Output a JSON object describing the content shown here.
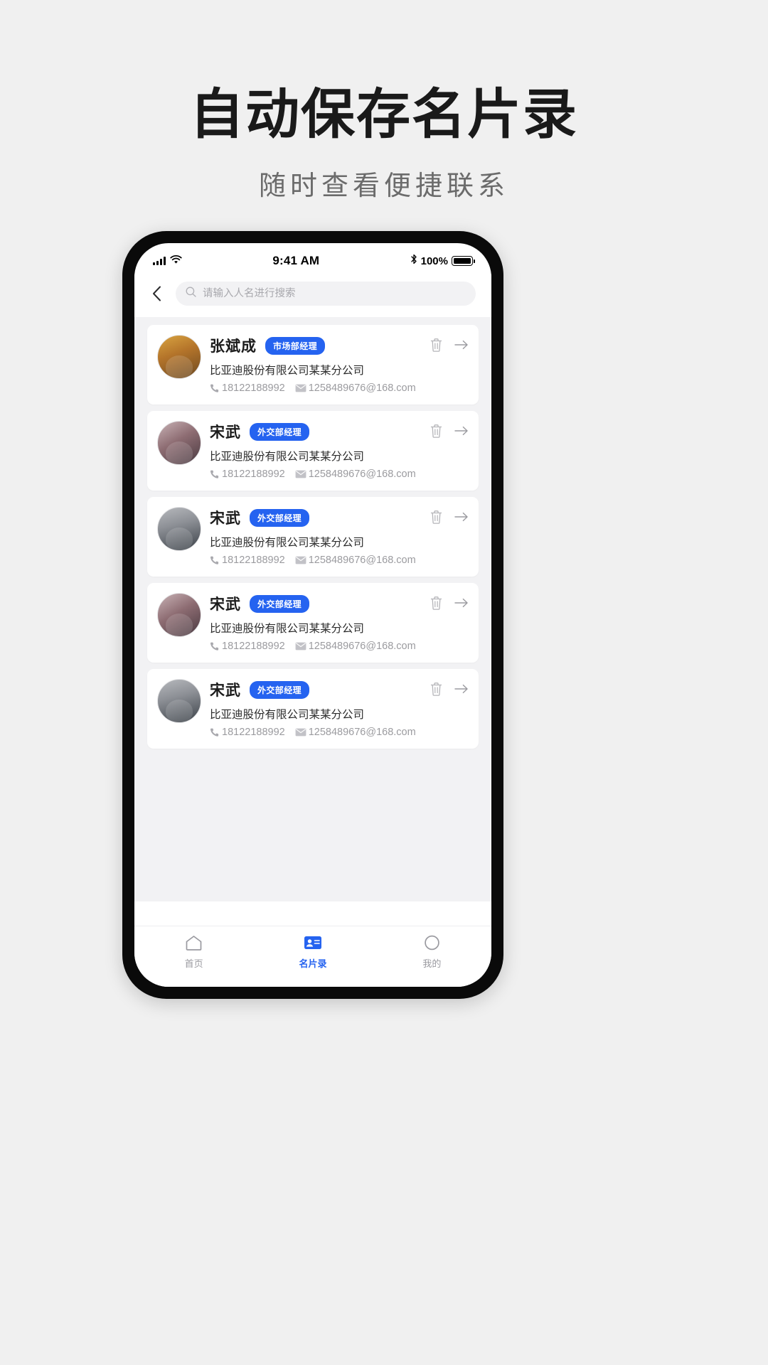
{
  "promo": {
    "title": "自动保存名片录",
    "subtitle": "随时查看便捷联系"
  },
  "statusbar": {
    "time": "9:41 AM",
    "battery_percent": "100%",
    "signal_icon": "cellular-signal-icon",
    "wifi_icon": "wifi-icon",
    "bluetooth_icon": "bluetooth-icon",
    "battery_icon": "battery-full-icon"
  },
  "header": {
    "back_icon": "chevron-left-icon",
    "search_icon": "search-icon",
    "search_placeholder": "请输入人名进行搜索",
    "search_value": ""
  },
  "colors": {
    "accent": "#2563f0",
    "page_bg": "#f0f0f0",
    "list_bg": "#f2f2f4",
    "card_bg": "#ffffff",
    "muted_text": "#9b9b9f"
  },
  "contacts": [
    {
      "name": "张斌成",
      "badge": "市场部经理",
      "company": "比亚迪股份有限公司某某分公司",
      "phone": "18122188992",
      "email": "1258489676@168.com",
      "avatar": "avatar-woman-sunset",
      "delete_icon": "trash-icon",
      "detail_icon": "arrow-right-icon"
    },
    {
      "name": "宋武",
      "badge": "外交部经理",
      "company": "比亚迪股份有限公司某某分公司",
      "phone": "18122188992",
      "email": "1258489676@168.com",
      "avatar": "avatar-woman-portrait",
      "delete_icon": "trash-icon",
      "detail_icon": "arrow-right-icon"
    },
    {
      "name": "宋武",
      "badge": "外交部经理",
      "company": "比亚迪股份有限公司某某分公司",
      "phone": "18122188992",
      "email": "1258489676@168.com",
      "avatar": "avatar-man-suit",
      "delete_icon": "trash-icon",
      "detail_icon": "arrow-right-icon"
    },
    {
      "name": "宋武",
      "badge": "外交部经理",
      "company": "比亚迪股份有限公司某某分公司",
      "phone": "18122188992",
      "email": "1258489676@168.com",
      "avatar": "avatar-woman-portrait",
      "delete_icon": "trash-icon",
      "detail_icon": "arrow-right-icon"
    },
    {
      "name": "宋武",
      "badge": "外交部经理",
      "company": "比亚迪股份有限公司某某分公司",
      "phone": "18122188992",
      "email": "1258489676@168.com",
      "avatar": "avatar-man-suit",
      "delete_icon": "trash-icon",
      "detail_icon": "arrow-right-icon"
    }
  ],
  "tabbar": {
    "items": [
      {
        "label": "首页",
        "icon": "home-icon",
        "active": false
      },
      {
        "label": "名片录",
        "icon": "card-list-icon",
        "active": true
      },
      {
        "label": "我的",
        "icon": "user-circle-icon",
        "active": false
      }
    ]
  }
}
